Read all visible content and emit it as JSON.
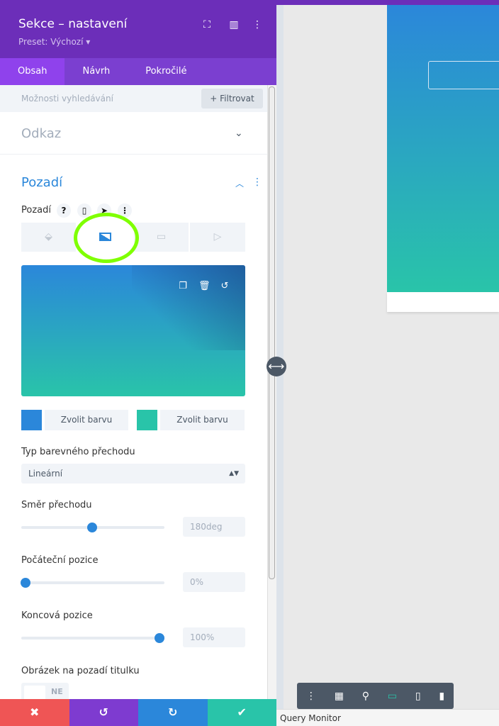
{
  "header": {
    "title": "Sekce – nastavení",
    "preset": "Preset: Výchozí ▾"
  },
  "tabs": [
    {
      "label": "Obsah",
      "active": true
    },
    {
      "label": "Návrh"
    },
    {
      "label": "Pokročilé"
    }
  ],
  "search": {
    "placeholder": "Možnosti vyhledávání",
    "filter_label": "+ Filtrovat"
  },
  "sections": {
    "link": "Odkaz",
    "background": "Pozadí"
  },
  "background": {
    "label": "Pozadí",
    "help": "?",
    "tabs": [
      "color",
      "gradient",
      "image",
      "video"
    ],
    "active_tab": "gradient",
    "gradient_start": "#2b87da",
    "gradient_end": "#29c4a9",
    "color1_label": "Zvolit barvu",
    "color2_label": "Zvolit barvu",
    "type_label": "Typ barevného přechodu",
    "type_value": "Lineární",
    "direction_label": "Směr přechodu",
    "direction_value": "180deg",
    "direction_fraction": 0.5,
    "start_label": "Počáteční pozice",
    "start_value": "0%",
    "start_fraction": 0,
    "end_label": "Koncová pozice",
    "end_value": "100%",
    "end_fraction": 1,
    "title_image_label": "Obrázek na pozadí titulku",
    "title_image_value": "NE"
  },
  "footer": {
    "query_monitor": "Query Monitor"
  },
  "colors": {
    "header": "#6c2eb9",
    "accent": "#2b87da",
    "cancel": "#ef5555",
    "undo": "#7e3bd0",
    "redo": "#2b87da",
    "save": "#29c4a9"
  }
}
